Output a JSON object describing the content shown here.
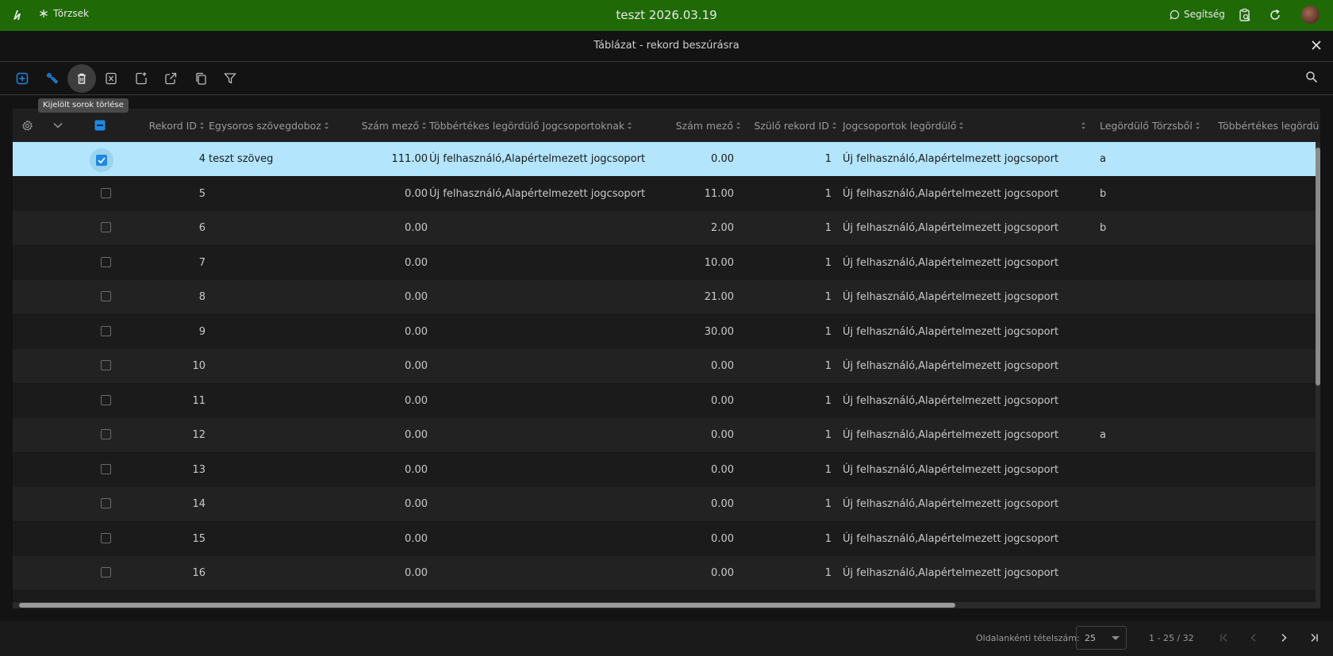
{
  "topbar": {
    "app_name": "Törzsek",
    "title": "teszt 2026.03.19",
    "help_label": "Segítség"
  },
  "dialog": {
    "title": "Táblázat - rekord beszúrásra"
  },
  "toolbar": {
    "tooltip": "Kijelölt sorok törlése"
  },
  "columns": {
    "rekord_id": "Rekord ID",
    "egysoros": "Egysoros szövegdoboz",
    "szam1": "Szám mező",
    "tobbertekes": "Többértékes legördülő Jogcsoportoknak",
    "szam2": "Szám mező",
    "szulo": "Szülő rekord ID",
    "jogcsop": "Jogcsoportok legördülő",
    "legordulo_torzs": "Legördülő Törzsből",
    "tobbertekes2": "Többértékes legördü"
  },
  "rows": [
    {
      "id": "4",
      "text": "teszt szöveg",
      "num1": "111.00",
      "multi": "Új felhasználó,Alapértelmezett jogcsoport",
      "num2": "0.00",
      "parent": "1",
      "group": "Új felhasználó,Alapértelmezett jogcsoport",
      "torzs": "a"
    },
    {
      "id": "5",
      "text": "",
      "num1": "0.00",
      "multi": "Új felhasználó,Alapértelmezett jogcsoport",
      "num2": "11.00",
      "parent": "1",
      "group": "Új felhasználó,Alapértelmezett jogcsoport",
      "torzs": "b"
    },
    {
      "id": "6",
      "text": "",
      "num1": "0.00",
      "multi": "",
      "num2": "2.00",
      "parent": "1",
      "group": "Új felhasználó,Alapértelmezett jogcsoport",
      "torzs": "b"
    },
    {
      "id": "7",
      "text": "",
      "num1": "0.00",
      "multi": "",
      "num2": "10.00",
      "parent": "1",
      "group": "Új felhasználó,Alapértelmezett jogcsoport",
      "torzs": ""
    },
    {
      "id": "8",
      "text": "",
      "num1": "0.00",
      "multi": "",
      "num2": "21.00",
      "parent": "1",
      "group": "Új felhasználó,Alapértelmezett jogcsoport",
      "torzs": ""
    },
    {
      "id": "9",
      "text": "",
      "num1": "0.00",
      "multi": "",
      "num2": "30.00",
      "parent": "1",
      "group": "Új felhasználó,Alapértelmezett jogcsoport",
      "torzs": ""
    },
    {
      "id": "10",
      "text": "",
      "num1": "0.00",
      "multi": "",
      "num2": "0.00",
      "parent": "1",
      "group": "Új felhasználó,Alapértelmezett jogcsoport",
      "torzs": ""
    },
    {
      "id": "11",
      "text": "",
      "num1": "0.00",
      "multi": "",
      "num2": "0.00",
      "parent": "1",
      "group": "Új felhasználó,Alapértelmezett jogcsoport",
      "torzs": ""
    },
    {
      "id": "12",
      "text": "",
      "num1": "0.00",
      "multi": "",
      "num2": "0.00",
      "parent": "1",
      "group": "Új felhasználó,Alapértelmezett jogcsoport",
      "torzs": "a"
    },
    {
      "id": "13",
      "text": "",
      "num1": "0.00",
      "multi": "",
      "num2": "0.00",
      "parent": "1",
      "group": "Új felhasználó,Alapértelmezett jogcsoport",
      "torzs": ""
    },
    {
      "id": "14",
      "text": "",
      "num1": "0.00",
      "multi": "",
      "num2": "0.00",
      "parent": "1",
      "group": "Új felhasználó,Alapértelmezett jogcsoport",
      "torzs": ""
    },
    {
      "id": "15",
      "text": "",
      "num1": "0.00",
      "multi": "",
      "num2": "0.00",
      "parent": "1",
      "group": "Új felhasználó,Alapértelmezett jogcsoport",
      "torzs": ""
    },
    {
      "id": "16",
      "text": "",
      "num1": "0.00",
      "multi": "",
      "num2": "0.00",
      "parent": "1",
      "group": "Új felhasználó,Alapértelmezett jogcsoport",
      "torzs": ""
    }
  ],
  "footer": {
    "page_size_label": "Oldalankénti tételszám:",
    "page_size": "25",
    "range": "1 - 25 / 32"
  }
}
